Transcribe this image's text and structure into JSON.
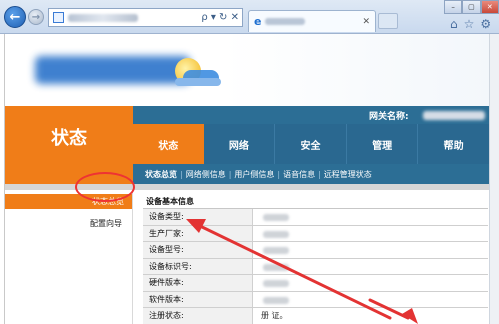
{
  "browser": {
    "nav": {
      "back_icon": "←",
      "forward_icon": "→"
    },
    "address": {
      "tools": "ρ ▾ ↻ ✕"
    },
    "tab": {
      "icon": "e",
      "close": "✕"
    },
    "window_controls": [
      "–",
      "▢",
      "✕"
    ],
    "right_icons": [
      "⌂",
      "☆",
      "⚙"
    ]
  },
  "header": {
    "gateway_label": "网关名称:",
    "status_title": "状态"
  },
  "tabs": [
    {
      "label": "状态",
      "active": true
    },
    {
      "label": "网络",
      "active": false
    },
    {
      "label": "安全",
      "active": false
    },
    {
      "label": "管理",
      "active": false
    },
    {
      "label": "帮助",
      "active": false
    }
  ],
  "subnav": [
    {
      "label": "状态总览",
      "active": true
    },
    {
      "label": "网络侧信息",
      "active": false
    },
    {
      "label": "用户侧信息",
      "active": false
    },
    {
      "label": "语音信息",
      "active": false
    },
    {
      "label": "远程管理状态",
      "active": false
    }
  ],
  "left_menu": {
    "active_item": "状态总览",
    "wizard_item": "配置向导"
  },
  "device_info": {
    "section_title": "设备基本信息",
    "rows": [
      {
        "label": "设备类型:",
        "value": ""
      },
      {
        "label": "生产厂家:",
        "value": ""
      },
      {
        "label": "设备型号:",
        "value": ""
      },
      {
        "label": "设备标识号:",
        "value": ""
      },
      {
        "label": "硬件版本:",
        "value": ""
      },
      {
        "label": "软件版本:",
        "value": ""
      },
      {
        "label": "注册状态:",
        "value": "册  证。"
      }
    ]
  },
  "colors": {
    "accent_orange": "#f07d18",
    "nav_blue": "#2a6890",
    "annotation_red": "#e33333"
  }
}
